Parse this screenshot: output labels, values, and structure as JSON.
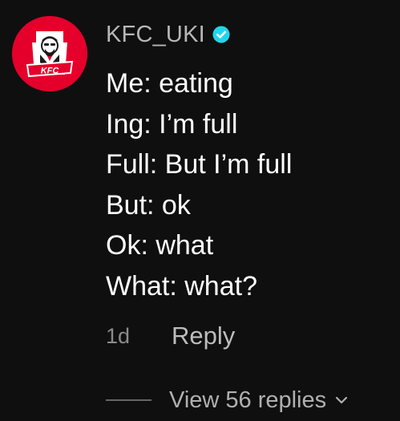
{
  "comment": {
    "author": {
      "username": "KFC_UKI",
      "verified": true,
      "avatar_logo_text": "KFC"
    },
    "lines": [
      "Me: eating",
      "Ing: I’m full",
      "Full: But I’m full",
      "But: ok",
      "Ok: what",
      "What: what?"
    ],
    "time": "1d",
    "reply_label": "Reply",
    "view_replies_label": "View 56 replies"
  },
  "icons": {
    "verified": "verified-badge-icon",
    "expand": "chevron-down-icon",
    "avatar": "kfc-logo-icon"
  },
  "colors": {
    "background": "#0f0f0f",
    "avatar_red": "#e4002b",
    "verified_blue": "#20d5ec",
    "text_primary": "#ffffff",
    "text_secondary": "#b7b7b7",
    "text_muted": "#8b8b8b"
  }
}
